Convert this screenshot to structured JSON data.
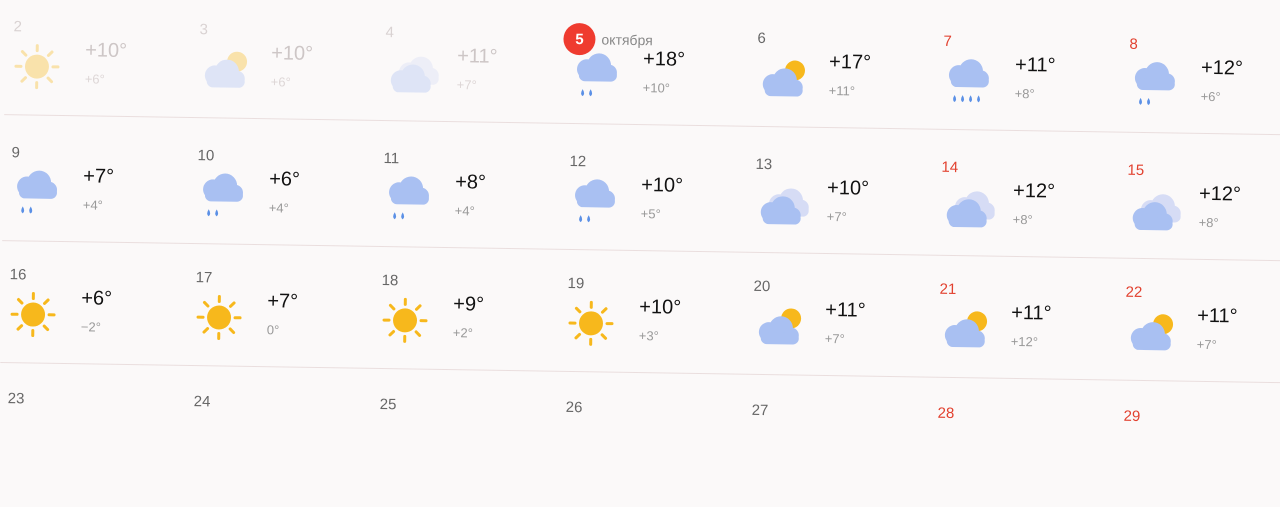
{
  "today": {
    "badge": "5",
    "month": "октября"
  },
  "rows": [
    [
      {
        "day": "2",
        "max": "+10°",
        "min": "+6°",
        "icon": "sun-icon",
        "weekend": false,
        "faded": true
      },
      {
        "day": "3",
        "max": "+10°",
        "min": "+6°",
        "icon": "partly-cloudy-icon",
        "weekend": false,
        "faded": true
      },
      {
        "day": "4",
        "max": "+11°",
        "min": "+7°",
        "icon": "overcast-icon",
        "weekend": false,
        "faded": true
      },
      {
        "day": "5",
        "max": "+18°",
        "min": "+10°",
        "icon": "rain-icon",
        "weekend": false,
        "faded": false,
        "today": true
      },
      {
        "day": "6",
        "max": "+17°",
        "min": "+11°",
        "icon": "partly-cloudy-icon",
        "weekend": false,
        "faded": false
      },
      {
        "day": "7",
        "max": "+11°",
        "min": "+8°",
        "icon": "heavy-rain-icon",
        "weekend": true,
        "faded": false
      },
      {
        "day": "8",
        "max": "+12°",
        "min": "+6°",
        "icon": "rain-icon",
        "weekend": true,
        "faded": false
      }
    ],
    [
      {
        "day": "9",
        "max": "+7°",
        "min": "+4°",
        "icon": "rain-icon",
        "weekend": false,
        "faded": false
      },
      {
        "day": "10",
        "max": "+6°",
        "min": "+4°",
        "icon": "rain-icon",
        "weekend": false,
        "faded": false
      },
      {
        "day": "11",
        "max": "+8°",
        "min": "+4°",
        "icon": "rain-icon",
        "weekend": false,
        "faded": false
      },
      {
        "day": "12",
        "max": "+10°",
        "min": "+5°",
        "icon": "rain-icon",
        "weekend": false,
        "faded": false
      },
      {
        "day": "13",
        "max": "+10°",
        "min": "+7°",
        "icon": "overcast-icon",
        "weekend": false,
        "faded": false
      },
      {
        "day": "14",
        "max": "+12°",
        "min": "+8°",
        "icon": "overcast-icon",
        "weekend": true,
        "faded": false
      },
      {
        "day": "15",
        "max": "+12°",
        "min": "+8°",
        "icon": "overcast-icon",
        "weekend": true,
        "faded": false
      }
    ],
    [
      {
        "day": "16",
        "max": "+6°",
        "min": "−2°",
        "icon": "sun-icon",
        "weekend": false,
        "faded": false
      },
      {
        "day": "17",
        "max": "+7°",
        "min": "0°",
        "icon": "sun-icon",
        "weekend": false,
        "faded": false
      },
      {
        "day": "18",
        "max": "+9°",
        "min": "+2°",
        "icon": "sun-icon",
        "weekend": false,
        "faded": false
      },
      {
        "day": "19",
        "max": "+10°",
        "min": "+3°",
        "icon": "sun-icon",
        "weekend": false,
        "faded": false
      },
      {
        "day": "20",
        "max": "+11°",
        "min": "+7°",
        "icon": "partly-cloudy-icon",
        "weekend": false,
        "faded": false
      },
      {
        "day": "21",
        "max": "+11°",
        "min": "+12°",
        "icon": "partly-cloudy-icon",
        "weekend": true,
        "faded": false
      },
      {
        "day": "22",
        "max": "+11°",
        "min": "+7°",
        "icon": "partly-cloudy-icon",
        "weekend": true,
        "faded": false
      }
    ],
    [
      {
        "day": "23",
        "weekend": false
      },
      {
        "day": "24",
        "weekend": false
      },
      {
        "day": "25",
        "weekend": false
      },
      {
        "day": "26",
        "weekend": false
      },
      {
        "day": "27",
        "weekend": false
      },
      {
        "day": "28",
        "weekend": true
      },
      {
        "day": "29",
        "weekend": true
      }
    ]
  ],
  "colors": {
    "sun": "#f7b81c",
    "cloud": "#a9c0f2",
    "cloud_light": "#d6dcf5",
    "rain": "#5b90e6",
    "weekend": "#e2412f",
    "today_badge": "#ef3b2f"
  }
}
